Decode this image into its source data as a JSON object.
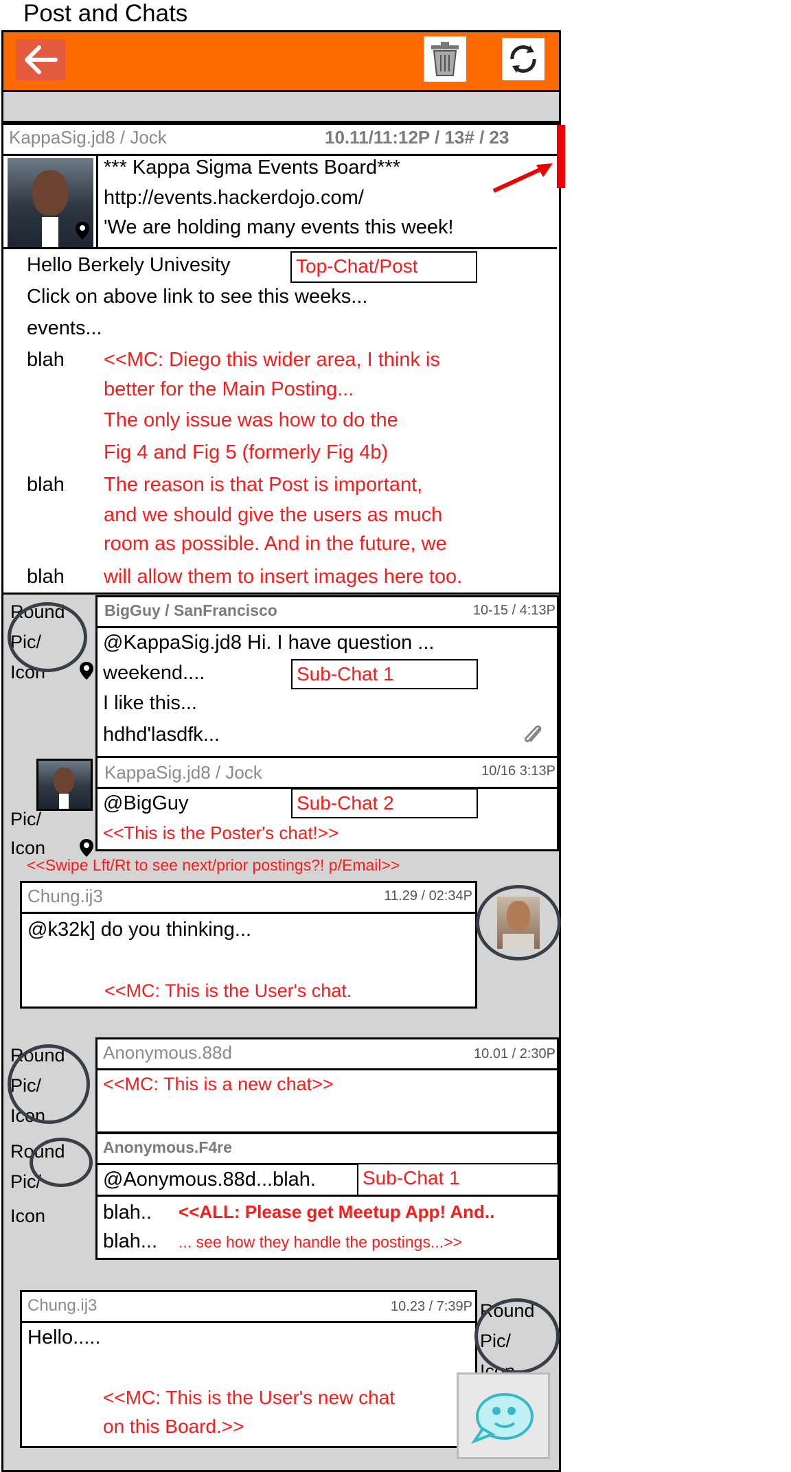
{
  "page_title": "Post and Chats",
  "topbar": {
    "back_icon": "back-arrow-icon",
    "trash_icon": "trash-icon",
    "refresh_icon": "refresh-icon"
  },
  "main_post": {
    "author": "KappaSig.jd8 / Jock",
    "meta": "10.11/11:12P / 13# / 23",
    "lines": [
      "*** Kappa Sigma Events Board***",
      "http://events.hackerdojo.com/",
      "'We are holding many events this week!"
    ],
    "body": [
      "Hello Berkely Univesity",
      "Click on above link to see this weeks...",
      "events..."
    ],
    "label": "Top-Chat/Post",
    "blah": "blah",
    "note": [
      "<<MC: Diego this wider area, I think is",
      "better for the Main Posting...",
      "The only issue was how to do the",
      "Fig 4 and Fig 5 (formerly Fig 4b)",
      "The reason is that Post is important,",
      "and we should give the users as much",
      "room as possible. And in the future, we",
      "will allow them to insert images here too."
    ]
  },
  "side_label": {
    "round": "Round",
    "pic": "Pic/",
    "icon": "Icon"
  },
  "sub_chat_1": {
    "author": "BigGuy / SanFrancisco",
    "time": "10-15 / 4:13P",
    "lines": [
      "@KappaSig.jd8 Hi. I have question ...",
      "weekend....",
      "I like this...",
      "hdhd'lasdfk..."
    ],
    "label": "Sub-Chat 1"
  },
  "sub_chat_2": {
    "author": "KappaSig.jd8 / Jock",
    "time": "10/16  3:13P",
    "line": "@BigGuy",
    "label": "Sub-Chat 2",
    "note": "<<This is the Poster's chat!>>",
    "side_pic": "Pic/",
    "side_icon": "Icon"
  },
  "swipe_note": "<<Swipe Lft/Rt to see next/prior postings?! p/Email>>",
  "user_chat": {
    "author": "Chung.ij3",
    "time": "11.29 / 02:34P",
    "line": "@k32k] do you thinking...",
    "note": "<<MC: This is the User's chat."
  },
  "new_chat": {
    "author": "Anonymous.88d",
    "time": "10.01 / 2:30P",
    "note": "<<MC: This is a new chat>>"
  },
  "anon_sub": {
    "author": "Anonymous.F4re",
    "line": "@Aonymous.88d...blah.",
    "label": "Sub-Chat 1",
    "blah1": "blah..",
    "blah2": "blah...",
    "note1": "<<ALL: Please get Meetup App! And..",
    "note2": "... see how they handle the postings...>>"
  },
  "user_new_chat": {
    "author": "Chung.ij3",
    "time": "10.23 / 7:39P",
    "line": "Hello.....",
    "note1": "<<MC: This is the User's new chat",
    "note2": "on this Board.>>"
  }
}
